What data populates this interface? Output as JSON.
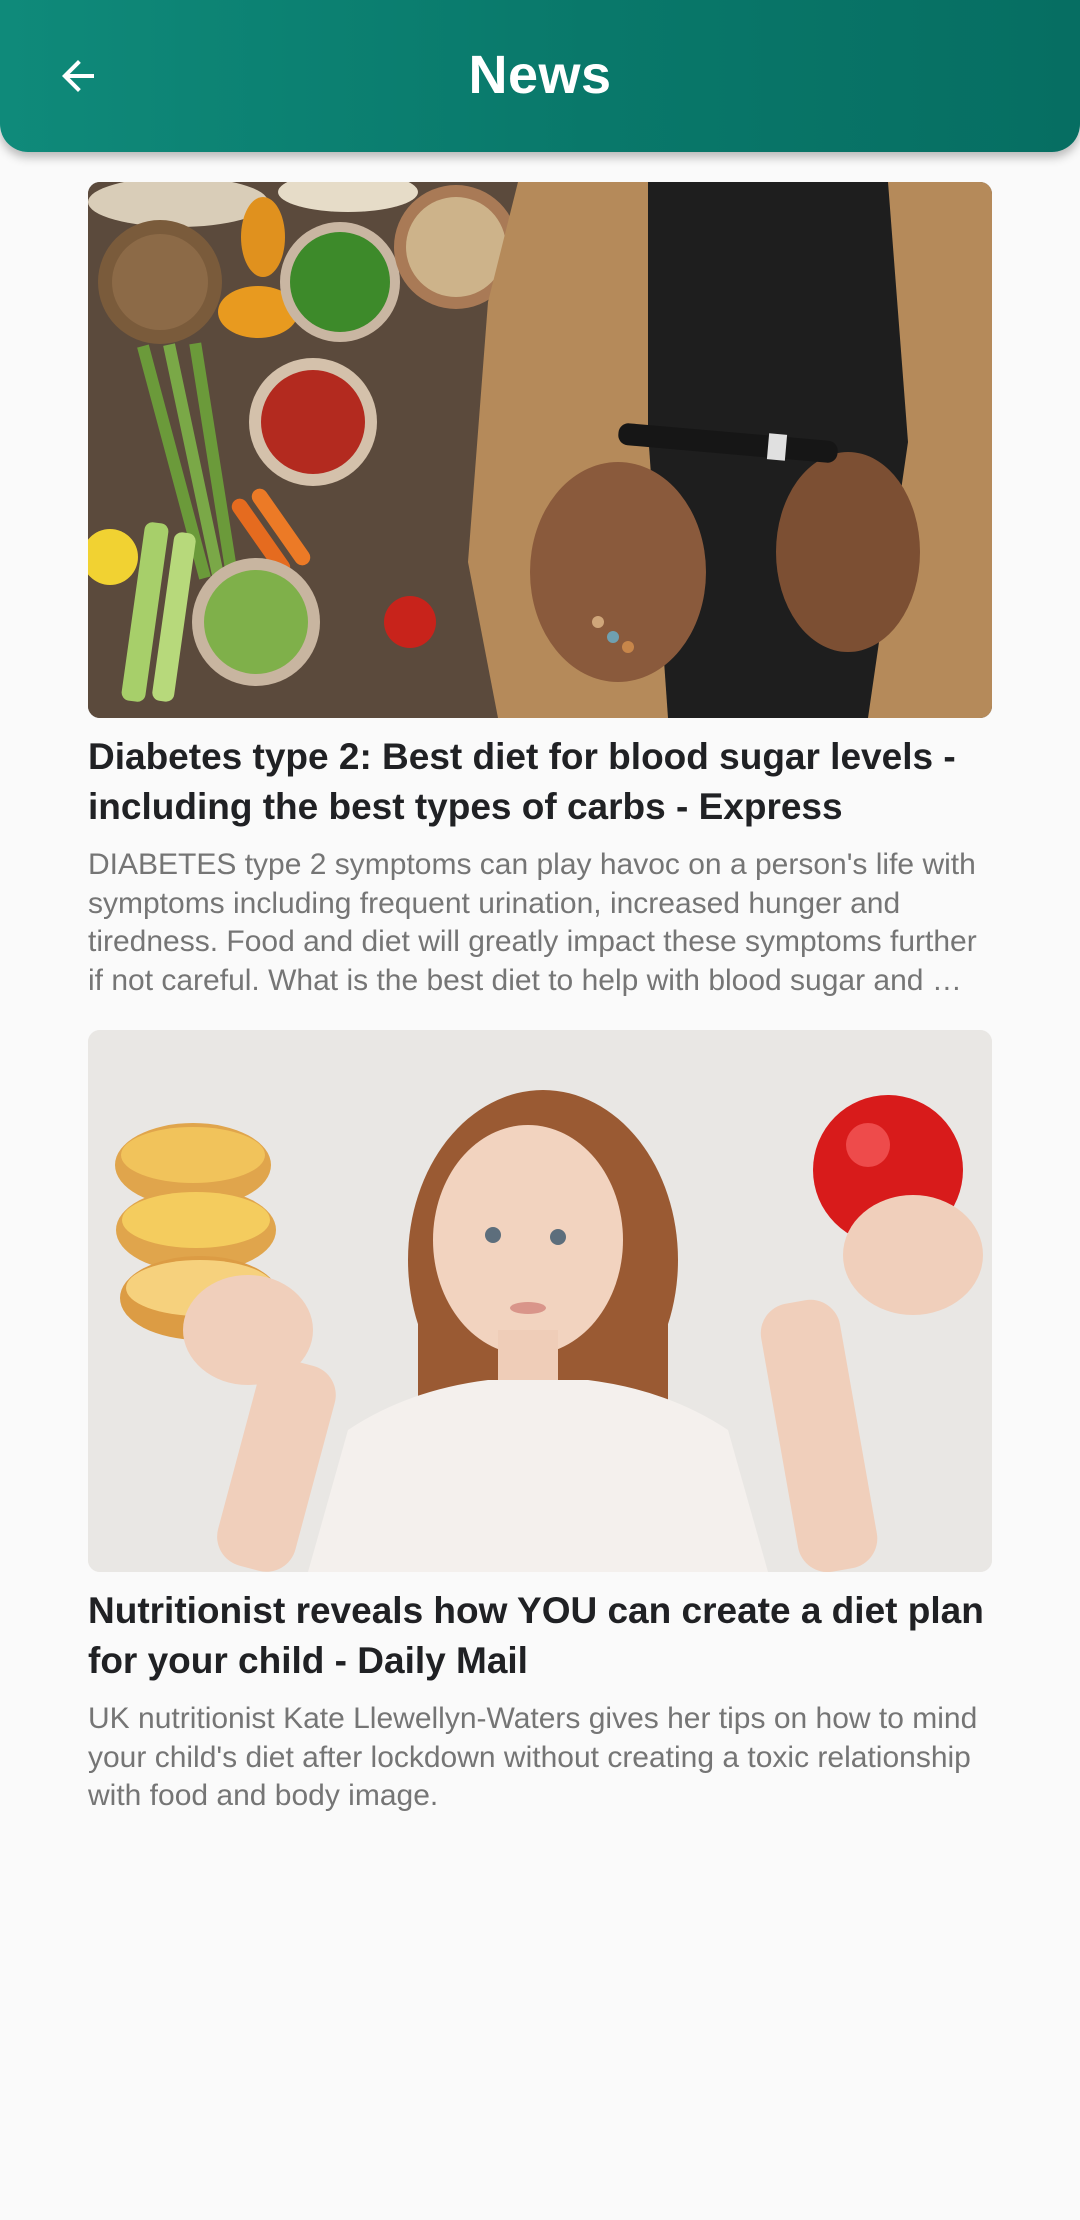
{
  "app_bar": {
    "title": "News",
    "back_icon": "arrow-left-icon",
    "colors": {
      "start": "#0f8a7a",
      "end": "#066e62",
      "text": "#ffffff"
    }
  },
  "articles": [
    {
      "title": "Diabetes type 2: Best diet for blood sugar levels - including the best types of carbs - Express",
      "description": "DIABETES type 2 symptoms can play havoc on a person's life with symptoms including frequent urination, increased hunger and tiredness. Food and diet will greatly impact these symptoms further if not careful. What is the best diet to help with blood sugar and …",
      "image": "healthy-food-and-glucose-meter-photo"
    },
    {
      "title": "Nutritionist reveals how YOU can create a diet plan for your child - Daily Mail",
      "description": "UK nutritionist Kate Llewellyn-Waters gives her tips on how to mind your child's diet after lockdown without creating a toxic relationship with food and body image.",
      "image": "girl-holding-donuts-and-apple-photo"
    }
  ]
}
